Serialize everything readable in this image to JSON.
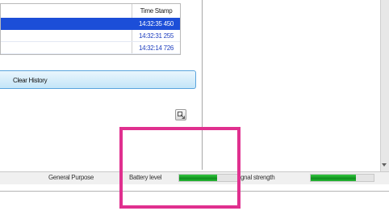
{
  "history": {
    "column_header": "Time Stamp",
    "rows": [
      {
        "time": "14:32:35 450",
        "selected": true
      },
      {
        "time": "14:32:31 255",
        "selected": false
      },
      {
        "time": "14:32:14 726",
        "selected": false
      }
    ]
  },
  "buttons": {
    "clear_history": "Clear History"
  },
  "status_bar": {
    "mode": "General Purpose",
    "battery_label": "Battery level",
    "battery_level": 0.65,
    "signal_label": "gnal strength",
    "signal_level": 0.72
  },
  "icons": {
    "small_button": "resize-icon",
    "scroll_down": "scroll-down-arrow-icon"
  },
  "colors": {
    "selection": "#1c4ed8",
    "accent_button": "#5aa4dd",
    "level_bar": "#1a9f2a",
    "annotation": "#e0308f"
  }
}
